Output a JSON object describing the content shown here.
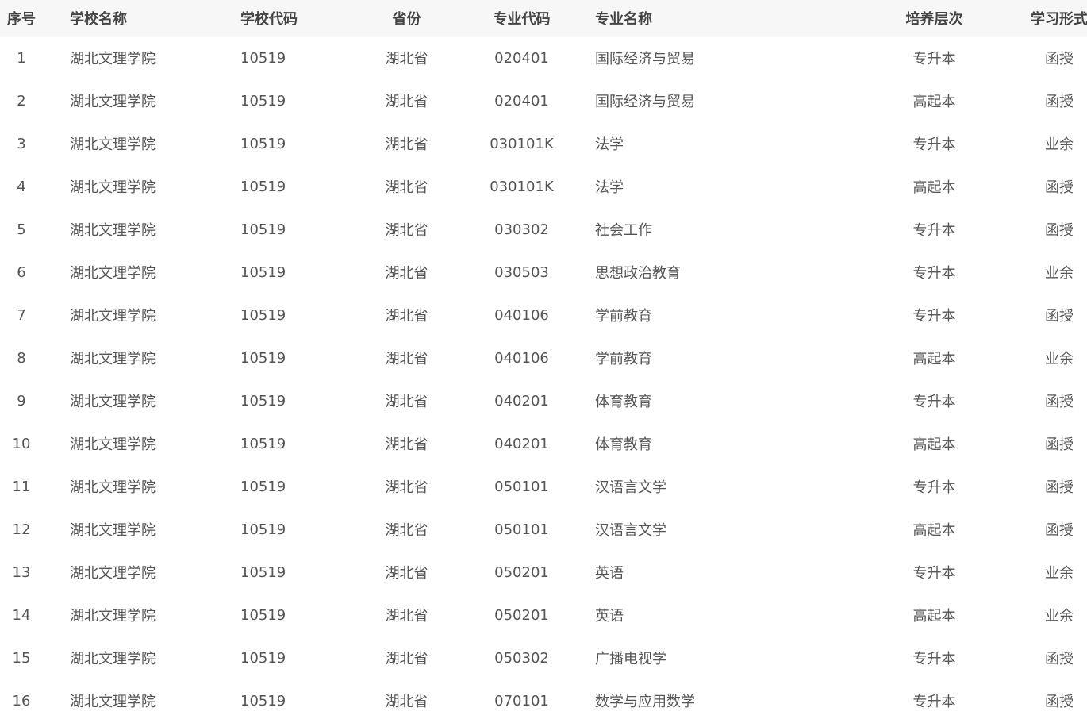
{
  "table": {
    "headers": {
      "seq": "序号",
      "school": "学校名称",
      "school_code": "学校代码",
      "province": "省份",
      "major_code": "专业代码",
      "major_name": "专业名称",
      "level": "培养层次",
      "study_form": "学习形式"
    },
    "rows": [
      {
        "seq": "1",
        "school": "湖北文理学院",
        "school_code": "10519",
        "province": "湖北省",
        "major_code": "020401",
        "major_name": "国际经济与贸易",
        "level": "专升本",
        "study_form": "函授"
      },
      {
        "seq": "2",
        "school": "湖北文理学院",
        "school_code": "10519",
        "province": "湖北省",
        "major_code": "020401",
        "major_name": "国际经济与贸易",
        "level": "高起本",
        "study_form": "函授"
      },
      {
        "seq": "3",
        "school": "湖北文理学院",
        "school_code": "10519",
        "province": "湖北省",
        "major_code": "030101K",
        "major_name": "法学",
        "level": "专升本",
        "study_form": "业余"
      },
      {
        "seq": "4",
        "school": "湖北文理学院",
        "school_code": "10519",
        "province": "湖北省",
        "major_code": "030101K",
        "major_name": "法学",
        "level": "高起本",
        "study_form": "函授"
      },
      {
        "seq": "5",
        "school": "湖北文理学院",
        "school_code": "10519",
        "province": "湖北省",
        "major_code": "030302",
        "major_name": "社会工作",
        "level": "专升本",
        "study_form": "函授"
      },
      {
        "seq": "6",
        "school": "湖北文理学院",
        "school_code": "10519",
        "province": "湖北省",
        "major_code": "030503",
        "major_name": "思想政治教育",
        "level": "专升本",
        "study_form": "业余"
      },
      {
        "seq": "7",
        "school": "湖北文理学院",
        "school_code": "10519",
        "province": "湖北省",
        "major_code": "040106",
        "major_name": "学前教育",
        "level": "专升本",
        "study_form": "函授"
      },
      {
        "seq": "8",
        "school": "湖北文理学院",
        "school_code": "10519",
        "province": "湖北省",
        "major_code": "040106",
        "major_name": "学前教育",
        "level": "高起本",
        "study_form": "业余"
      },
      {
        "seq": "9",
        "school": "湖北文理学院",
        "school_code": "10519",
        "province": "湖北省",
        "major_code": "040201",
        "major_name": "体育教育",
        "level": "专升本",
        "study_form": "函授"
      },
      {
        "seq": "10",
        "school": "湖北文理学院",
        "school_code": "10519",
        "province": "湖北省",
        "major_code": "040201",
        "major_name": "体育教育",
        "level": "高起本",
        "study_form": "函授"
      },
      {
        "seq": "11",
        "school": "湖北文理学院",
        "school_code": "10519",
        "province": "湖北省",
        "major_code": "050101",
        "major_name": "汉语言文学",
        "level": "专升本",
        "study_form": "函授"
      },
      {
        "seq": "12",
        "school": "湖北文理学院",
        "school_code": "10519",
        "province": "湖北省",
        "major_code": "050101",
        "major_name": "汉语言文学",
        "level": "高起本",
        "study_form": "函授"
      },
      {
        "seq": "13",
        "school": "湖北文理学院",
        "school_code": "10519",
        "province": "湖北省",
        "major_code": "050201",
        "major_name": "英语",
        "level": "专升本",
        "study_form": "业余"
      },
      {
        "seq": "14",
        "school": "湖北文理学院",
        "school_code": "10519",
        "province": "湖北省",
        "major_code": "050201",
        "major_name": "英语",
        "level": "高起本",
        "study_form": "业余"
      },
      {
        "seq": "15",
        "school": "湖北文理学院",
        "school_code": "10519",
        "province": "湖北省",
        "major_code": "050302",
        "major_name": "广播电视学",
        "level": "专升本",
        "study_form": "函授"
      },
      {
        "seq": "16",
        "school": "湖北文理学院",
        "school_code": "10519",
        "province": "湖北省",
        "major_code": "070101",
        "major_name": "数学与应用数学",
        "level": "专升本",
        "study_form": "函授"
      }
    ]
  }
}
